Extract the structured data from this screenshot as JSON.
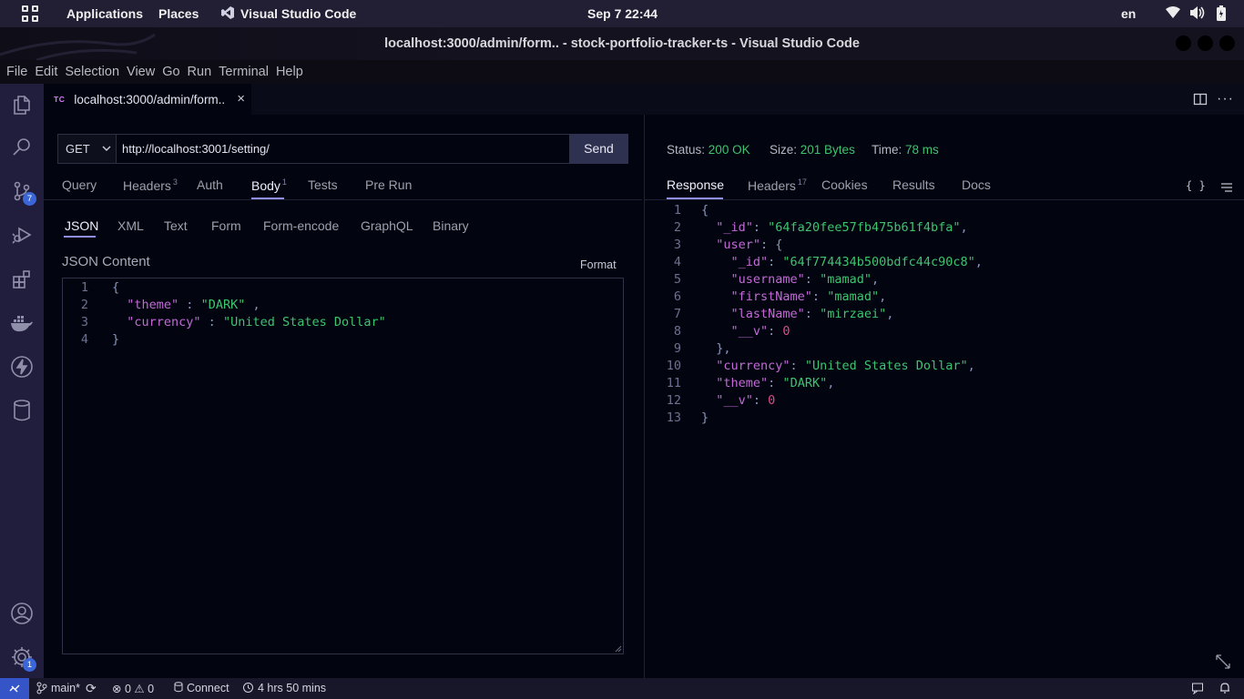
{
  "gnome": {
    "applications": "Applications",
    "places": "Places",
    "app_name": "Visual Studio Code",
    "clock": "Sep 7  22:44",
    "lang": "en"
  },
  "window": {
    "title": "localhost:3000/admin/form.. - stock-portfolio-tracker-ts - Visual Studio Code"
  },
  "menu": [
    "File",
    "Edit",
    "Selection",
    "View",
    "Go",
    "Run",
    "Terminal",
    "Help"
  ],
  "activity": {
    "scm_badge": "7",
    "settings_badge": "1"
  },
  "tab": {
    "icon_text": "TC",
    "label": "localhost:3000/admin/form..",
    "close": "×"
  },
  "request": {
    "method": "GET",
    "url": "http://localhost:3001/setting/",
    "send": "Send",
    "tabs": [
      {
        "label": "Query",
        "sup": ""
      },
      {
        "label": "Headers",
        "sup": "3"
      },
      {
        "label": "Auth",
        "sup": ""
      },
      {
        "label": "Body",
        "sup": "1"
      },
      {
        "label": "Tests",
        "sup": ""
      },
      {
        "label": "Pre Run",
        "sup": ""
      }
    ],
    "body_types": [
      "JSON",
      "XML",
      "Text",
      "Form",
      "Form-encode",
      "GraphQL",
      "Binary"
    ],
    "json_label": "JSON Content",
    "format": "Format",
    "body_lines": [
      "1",
      "2",
      "3",
      "4"
    ]
  },
  "response": {
    "status_label": "Status:",
    "status_value": "200 OK",
    "size_label": "Size:",
    "size_value": "201 Bytes",
    "time_label": "Time:",
    "time_value": "78 ms",
    "tabs": [
      {
        "label": "Response",
        "sup": ""
      },
      {
        "label": "Headers",
        "sup": "17"
      },
      {
        "label": "Cookies",
        "sup": ""
      },
      {
        "label": "Results",
        "sup": ""
      },
      {
        "label": "Docs",
        "sup": ""
      }
    ],
    "braces_icon": "{ }",
    "line_numbers": [
      "1",
      "2",
      "3",
      "4",
      "5",
      "6",
      "7",
      "8",
      "9",
      "10",
      "11",
      "12",
      "13"
    ]
  },
  "statusbar": {
    "branch": "main*",
    "errors": "0",
    "warnings": "0",
    "connect": "Connect",
    "time": "4 hrs 50 mins"
  }
}
